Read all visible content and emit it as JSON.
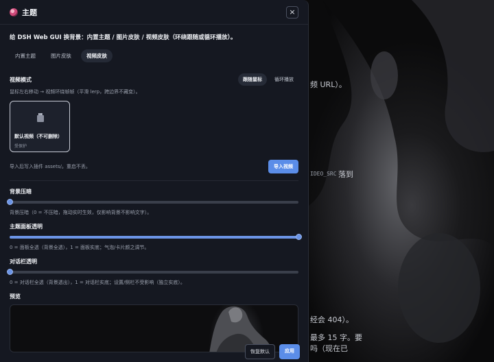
{
  "dialog": {
    "title": "主题",
    "close_glyph": "×",
    "description": "给 DSH Web GUI 换背景：内置主题 / 图片皮肤 / 视频皮肤（环绕跟随或循环播放）。",
    "tabs": [
      {
        "label": "内置主题",
        "active": false
      },
      {
        "label": "图片皮肤",
        "active": false
      },
      {
        "label": "视频皮肤",
        "active": true
      }
    ]
  },
  "video_mode": {
    "title": "视频模式",
    "modes": [
      {
        "label": "跟随鼠标",
        "active": true
      },
      {
        "label": "循环播放",
        "active": false
      }
    ],
    "hint": "鼠标左右移动 → 视频环绕帧帧（平滑 lerp，跨边界不藏变）。"
  },
  "video_card": {
    "icon": "clapperboard-icon",
    "title": "默认视频（不可删除）",
    "subtitle": "受保护"
  },
  "import": {
    "hint": "导入后写入插件 assets/。重启不丢。",
    "button_label": "导入视频"
  },
  "sliders": [
    {
      "title": "背景压暗",
      "value": 0.0,
      "description": "背景压暗（0 = 不压暗，拖动实时生效，仅影响背景不影响文字）。"
    },
    {
      "title": "主题面板透明",
      "value": 1.0,
      "description": "0 = 面板全透（背景全透），1 = 面板实底；气泡/卡片颜之调节。"
    },
    {
      "title": "对话栏透明",
      "value": 0.0,
      "description": "0 = 对话栏全透（背景透出），1 = 对话栏实底；设置/侧栏不受影响（独立实底）。"
    }
  ],
  "preview": {
    "title": "预览"
  },
  "footer": {
    "reset_label": "恢复默认",
    "apply_label": "应用"
  },
  "background_text": {
    "line1": "频 URL）。",
    "code": "IDEO_SRC",
    "line2": "落到",
    "line3": "经会 404）。",
    "line4": "最多 15 字。要",
    "line5": "吗（现在已"
  },
  "colors": {
    "accent": "#5b8de8",
    "panel": "#151821"
  }
}
